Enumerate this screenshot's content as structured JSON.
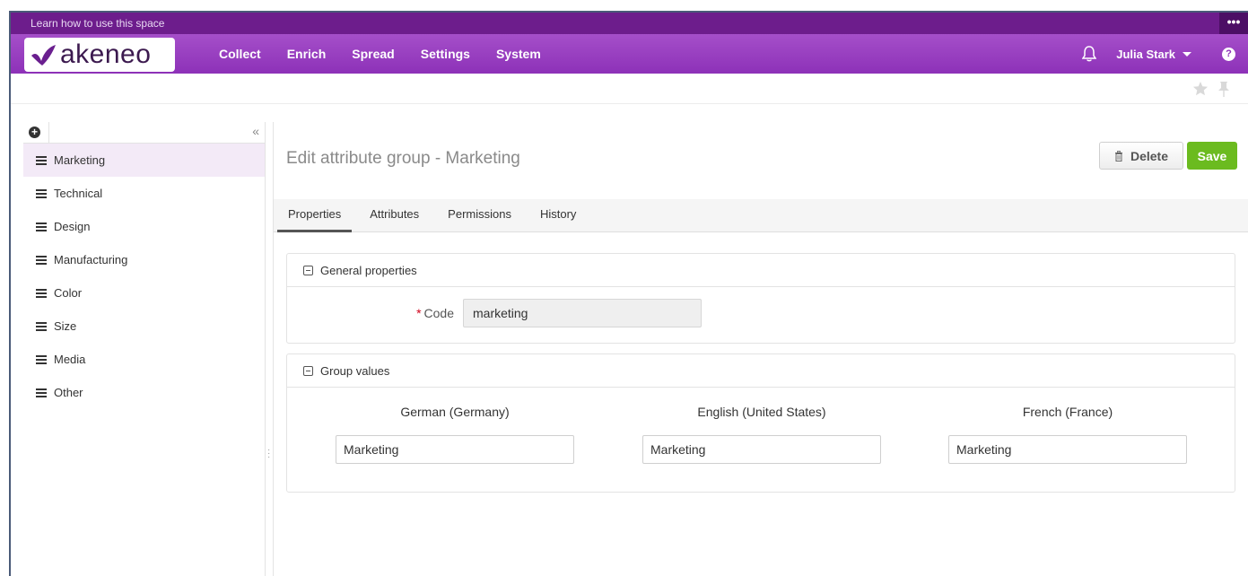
{
  "learn_bar": {
    "text": "Learn how to use this space",
    "more": "•••"
  },
  "brand": {
    "name": "akeneo",
    "color": "#8d31b8"
  },
  "nav": {
    "items": [
      "Collect",
      "Enrich",
      "Spread",
      "Settings",
      "System"
    ],
    "user": "Julia Stark",
    "help": "?"
  },
  "sidebar": {
    "add": "+",
    "collapse": "«",
    "items": [
      "Marketing",
      "Technical",
      "Design",
      "Manufacturing",
      "Color",
      "Size",
      "Media",
      "Other"
    ],
    "active_index": 0
  },
  "main": {
    "title": "Edit attribute group - Marketing",
    "delete_label": "Delete",
    "save_label": "Save",
    "tabs": [
      "Properties",
      "Attributes",
      "Permissions",
      "History"
    ],
    "active_tab": "Properties",
    "general": {
      "title": "General properties",
      "code_label": "Code",
      "required_mark": "*",
      "code_value": "marketing"
    },
    "group_values": {
      "title": "Group values",
      "locales": [
        {
          "label": "German (Germany)",
          "value": "Marketing"
        },
        {
          "label": "English (United States)",
          "value": "Marketing"
        },
        {
          "label": "French (France)",
          "value": "Marketing"
        }
      ]
    }
  },
  "colors": {
    "nav": "#8d31b8",
    "learn_bar": "#6d1d8c",
    "save": "#6bbb1f",
    "required": "#d0021b"
  }
}
